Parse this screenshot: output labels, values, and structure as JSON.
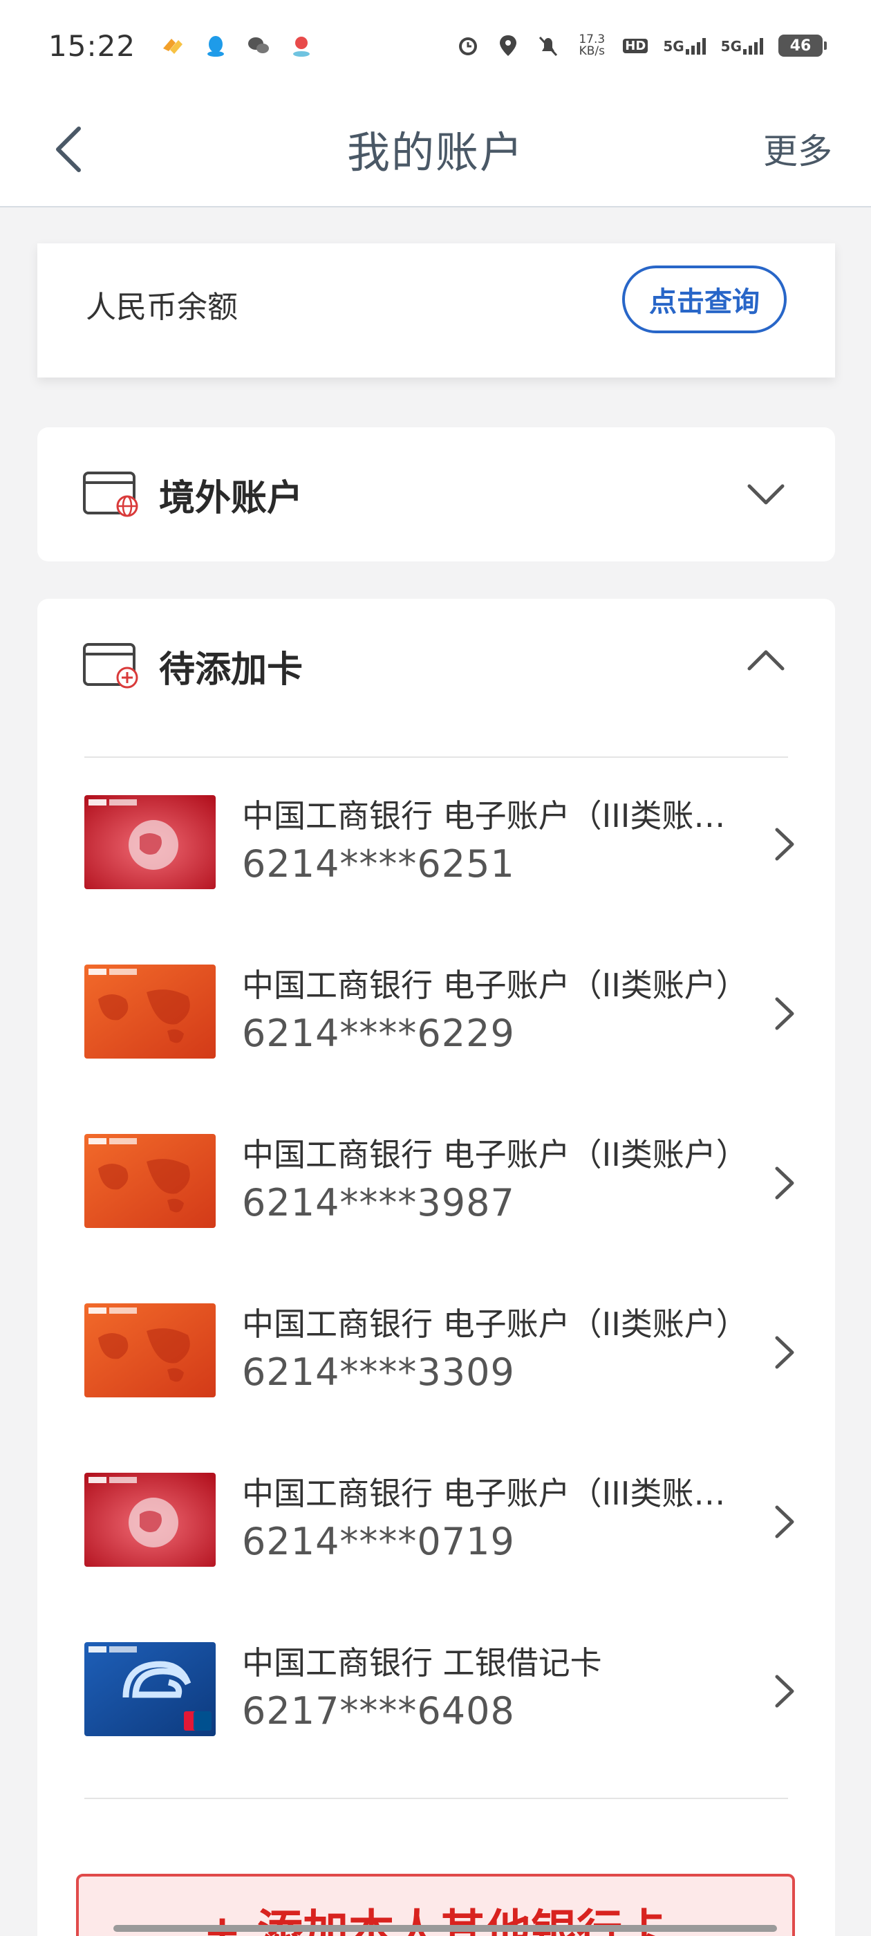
{
  "status_bar": {
    "time": "15:22",
    "speed_value": "17.3",
    "speed_unit": "KB/s",
    "hd_label": "HD",
    "net1": "5G",
    "net2": "5G",
    "battery": "46"
  },
  "header": {
    "title": "我的账户",
    "more": "更多"
  },
  "balance": {
    "label": "人民币余额",
    "query_button": "点击查询"
  },
  "sections": {
    "overseas": {
      "title": "境外账户"
    },
    "pending": {
      "title": "待添加卡"
    }
  },
  "cards": [
    {
      "name": "中国工商银行  电子账户（III类账户）",
      "number": "6214****6251",
      "style": "red"
    },
    {
      "name": "中国工商银行  电子账户（II类账户）",
      "number": "6214****6229",
      "style": "orange"
    },
    {
      "name": "中国工商银行  电子账户（II类账户）",
      "number": "6214****3987",
      "style": "orange"
    },
    {
      "name": "中国工商银行  电子账户（II类账户）",
      "number": "6214****3309",
      "style": "orange"
    },
    {
      "name": "中国工商银行  电子账户（III类账户）",
      "number": "6214****0719",
      "style": "red"
    },
    {
      "name": "中国工商银行  工银借记卡",
      "number": "6217****6408",
      "style": "blue"
    }
  ],
  "add_button": {
    "label": "+ 添加本人其他银行卡"
  },
  "colors": {
    "accent_blue": "#2866c8",
    "add_red": "#d8231f"
  }
}
